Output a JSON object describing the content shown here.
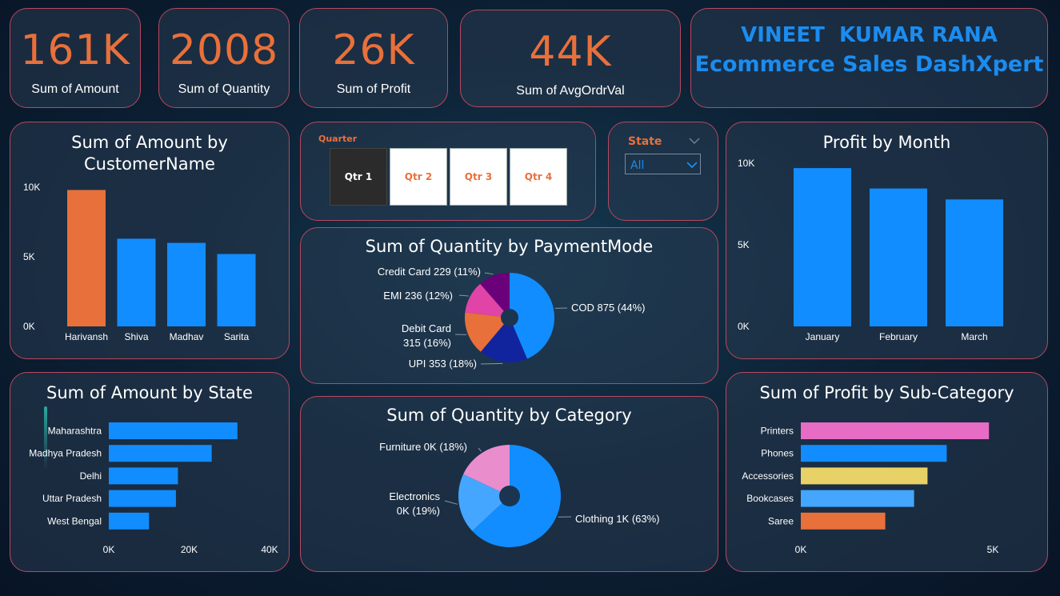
{
  "kpis": [
    {
      "value": "161K",
      "label": "Sum of Amount"
    },
    {
      "value": "2008",
      "label": "Sum of Quantity"
    },
    {
      "value": "26K",
      "label": "Sum of Profit"
    },
    {
      "value": "44K",
      "label": "Sum of AvgOrdrVal"
    }
  ],
  "header": {
    "line1": "VINEET  KUMAR RANA",
    "line2": "Ecommerce Sales DashXpert"
  },
  "quarter_slicer": {
    "label": "Quarter",
    "options": [
      "Qtr 1",
      "Qtr 2",
      "Qtr 3",
      "Qtr 4"
    ],
    "selected": "Qtr 1"
  },
  "state_slicer": {
    "label": "State",
    "value": "All"
  },
  "colors": {
    "orange": "#e8703a",
    "blue": "#118dff",
    "navy": "#12239e",
    "pink": "#e044a7",
    "purple": "#6b007b",
    "violet_pink": "#e66cc4",
    "yellow": "#e8d166",
    "light_blue": "#44a6ff",
    "light_pink": "#ea8dcd",
    "card_border": "#b8485f",
    "title_blue": "#1b8cf0"
  },
  "chart_data": [
    {
      "type": "bar",
      "title": "Sum of Amount by CustomerName",
      "title_lines": [
        "Sum of Amount by",
        "CustomerName"
      ],
      "categories": [
        "Harivansh",
        "Shiva",
        "Madhav",
        "Sarita"
      ],
      "values": [
        9800,
        6300,
        6000,
        5200
      ],
      "highlight_index": 0,
      "yticks": [
        "0K",
        "5K",
        "10K"
      ],
      "ylim": [
        0,
        10000
      ]
    },
    {
      "type": "bar",
      "title": "Profit by Month",
      "categories": [
        "January",
        "February",
        "March"
      ],
      "values": [
        9700,
        8450,
        7780
      ],
      "yticks": [
        "0K",
        "5K",
        "10K"
      ],
      "ylim": [
        0,
        10000
      ]
    },
    {
      "type": "bar",
      "orientation": "horizontal",
      "title": "Sum of Amount by State",
      "categories": [
        "Maharashtra",
        "Madhya Pradesh",
        "Delhi",
        "Uttar Pradesh",
        "West Bengal"
      ],
      "values": [
        32000,
        25600,
        17200,
        16700,
        10000
      ],
      "xticks": [
        "0K",
        "20K",
        "40K"
      ],
      "xlim": [
        0,
        40000
      ]
    },
    {
      "type": "bar",
      "orientation": "horizontal",
      "title": "Sum of Profit by Sub-Category",
      "categories": [
        "Printers",
        "Phones",
        "Accessories",
        "Bookcases",
        "Saree"
      ],
      "values": [
        4900,
        3800,
        3300,
        2950,
        2200
      ],
      "bar_colors": [
        "#e66cc4",
        "#118dff",
        "#e8d166",
        "#44a6ff",
        "#e8703a"
      ],
      "xticks": [
        "0K",
        "5K"
      ],
      "xlim": [
        0,
        5000
      ]
    },
    {
      "type": "pie",
      "title": "Sum of Quantity by PaymentMode",
      "slices": [
        {
          "name": "COD",
          "value": 875,
          "label_lines": [
            "COD 875 (44%)"
          ],
          "color": "#118dff"
        },
        {
          "name": "UPI",
          "value": 353,
          "label_lines": [
            "UPI 353 (18%)"
          ],
          "color": "#12239e"
        },
        {
          "name": "Debit Card",
          "value": 315,
          "label_lines": [
            "Debit Card",
            "315 (16%)"
          ],
          "color": "#e8703a"
        },
        {
          "name": "EMI",
          "value": 236,
          "label_lines": [
            "EMI 236 (12%)"
          ],
          "color": "#e044a7"
        },
        {
          "name": "Credit Card",
          "value": 229,
          "label_lines": [
            "Credit Card 229 (11%)"
          ],
          "color": "#6b007b"
        }
      ]
    },
    {
      "type": "pie",
      "title": "Sum of Quantity by Category",
      "slices": [
        {
          "name": "Clothing",
          "value": 63,
          "label_lines": [
            "Clothing 1K (63%)"
          ],
          "color": "#118dff"
        },
        {
          "name": "Electronics",
          "value": 19,
          "label_lines": [
            "Electronics",
            "0K (19%)"
          ],
          "color": "#44a6ff"
        },
        {
          "name": "Furniture",
          "value": 18,
          "label_lines": [
            "Furniture 0K (18%)"
          ],
          "color": "#ea8dcd"
        }
      ]
    }
  ]
}
